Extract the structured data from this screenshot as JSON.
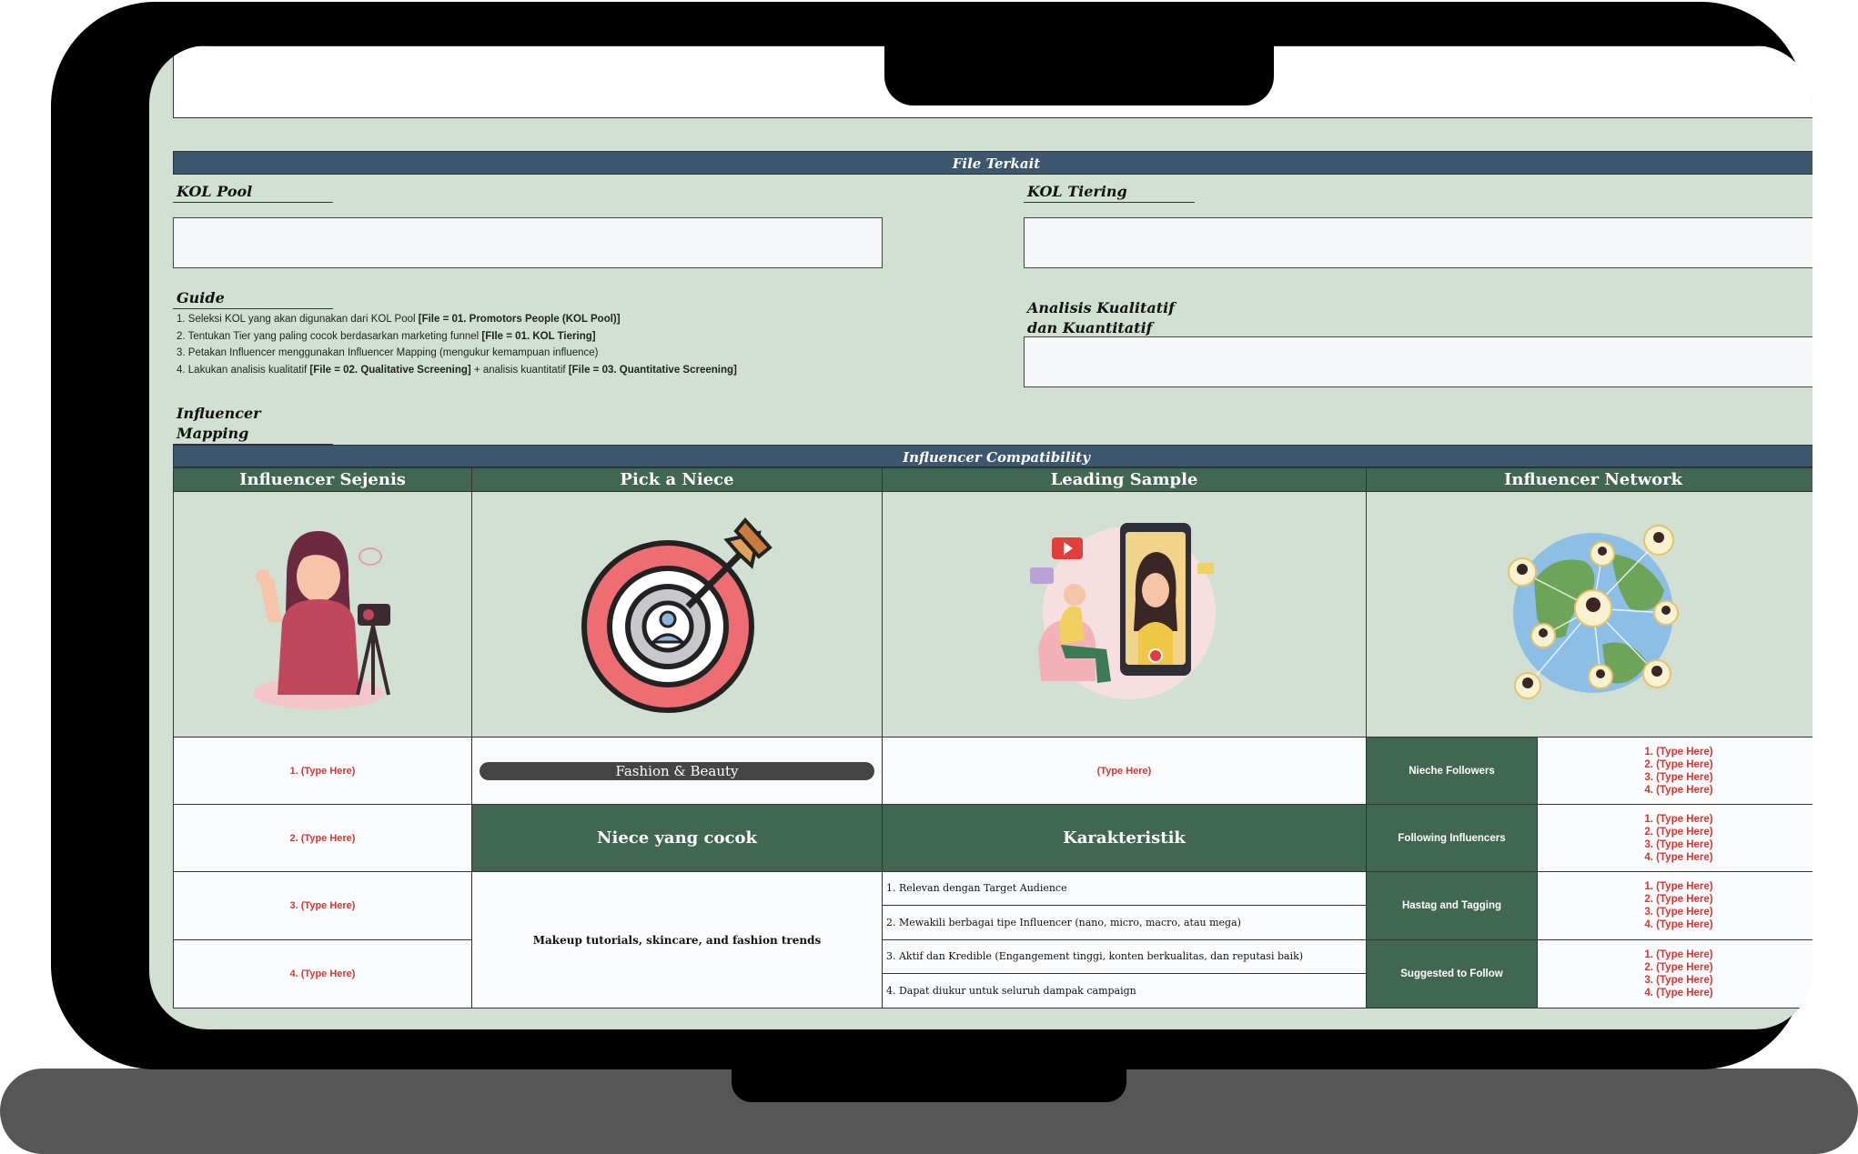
{
  "sections": {
    "file_terkait": "File Terkait",
    "kol_pool": "KOL Pool",
    "kol_tiering": "KOL Tiering",
    "guide": "Guide",
    "analisis": "Analisis Kualitatif dan Kuantitatif",
    "influencer_mapping": "Influencer Mapping",
    "compatibility": "Influencer Compatibility"
  },
  "guide_items": [
    {
      "text": "1. Seleksi KOL yang akan digunakan dari KOL Pool ",
      "bold": "[File = 01. Promotors People (KOL Pool)]"
    },
    {
      "text": "2. Tentukan Tier yang paling cocok berdasarkan marketing funnel ",
      "bold": "[FIle = 01. KOL Tiering]"
    },
    {
      "text": "3. Petakan Influencer menggunakan Influencer Mapping (mengukur kemampuan influence)",
      "bold": ""
    },
    {
      "text": "4. Lakukan analisis kualitatif ",
      "bold": "[File = 02. Qualitative Screening]",
      "text2": " + analisis kuantitatif ",
      "bold2": "[File = 03. Quantitative Screening]"
    }
  ],
  "columns": [
    "Influencer Sejenis",
    "Pick a Niece",
    "Leading Sample",
    "Influencer Network"
  ],
  "sejenis": [
    "1. (Type Here)",
    "2. (Type Here)",
    "3. (Type Here)",
    "4. (Type Here)"
  ],
  "niece_value": "Fashion & Beauty",
  "niece_cocok_head": "Niece yang cocok",
  "niece_cocok_value": "Makeup tutorials, skincare, and fashion trends",
  "leading_sample": "(Type Here)",
  "karakteristik_head": "Karakteristik",
  "karakteristik": [
    "1. Relevan dengan Target Audience",
    "2. Mewakili berbagai tipe Influencer (nano, micro, macro, atau mega)",
    "3. Aktif dan Kredible (Engangement tinggi, konten berkualitas, dan reputasi baik)",
    "4. Dapat diukur untuk seluruh dampak campaign"
  ],
  "network": [
    {
      "label": "Nieche Followers",
      "items": [
        "1. (Type Here)",
        "2. (Type Here)",
        "3. (Type Here)",
        "4. (Type Here)"
      ]
    },
    {
      "label": "Following Influencers",
      "items": [
        "1. (Type Here)",
        "2. (Type Here)",
        "3. (Type Here)",
        "4. (Type Here)"
      ]
    },
    {
      "label": "Hastag and Tagging",
      "items": [
        "1. (Type Here)",
        "2. (Type Here)",
        "3. (Type Here)",
        "4. (Type Here)"
      ]
    },
    {
      "label": "Suggested to Follow",
      "items": [
        "1. (Type Here)",
        "2. (Type Here)",
        "3. (Type Here)",
        "4. (Type Here)"
      ]
    }
  ],
  "colors": {
    "bar": "#3d576f",
    "header_green": "#416651",
    "background": "#d1e0d3",
    "red_text": "#d03a34"
  }
}
